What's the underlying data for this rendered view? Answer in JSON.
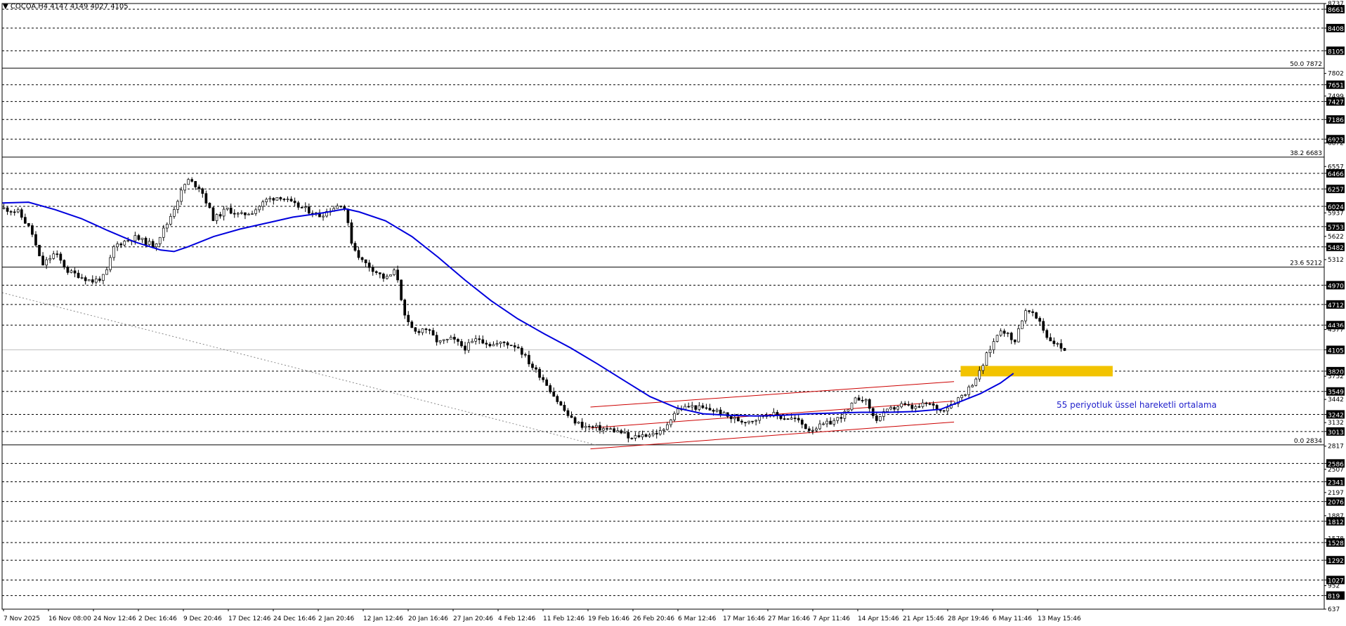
{
  "symbol_header": "▼ COCOA.H4  4147 4149 4027 4105",
  "chart_data": {
    "type": "candlestick",
    "symbol": "COCOA",
    "timeframe": "H4",
    "ohlc_header": {
      "open": 4147,
      "high": 4149,
      "low": 4027,
      "close": 4105
    },
    "ylim": [
      637,
      8737
    ],
    "price_ticks": [
      8737,
      8661,
      8408,
      8105,
      7802,
      7651,
      7499,
      7427,
      7186,
      6923,
      6872,
      6557,
      6466,
      6257,
      6024,
      5937,
      5753,
      5622,
      5482,
      5312,
      4970,
      4712,
      4436,
      4377,
      4105,
      3820,
      3752,
      3549,
      3442,
      3242,
      3132,
      3013,
      2817,
      2586,
      2507,
      2341,
      2197,
      2076,
      1887,
      1812,
      1578,
      1528,
      1292,
      1027,
      952,
      819,
      637
    ],
    "highlighted_ticks": [
      8661,
      8408,
      8105,
      7651,
      7427,
      7186,
      6923,
      6466,
      6257,
      6024,
      5753,
      5482,
      4970,
      4712,
      4436,
      4105,
      3820,
      3549,
      3242,
      3013,
      2586,
      2341,
      2076,
      1812,
      1528,
      1292,
      1027,
      819
    ],
    "support_resistance_levels": [
      8661,
      8408,
      8105,
      7651,
      7427,
      7186,
      6923,
      6466,
      6257,
      6024,
      5753,
      5482,
      4970,
      4712,
      4436,
      3820,
      3549,
      3242,
      3013,
      2586,
      2341,
      2076,
      1812,
      1528,
      1292,
      1027,
      819
    ],
    "current_price": 4105,
    "fibonacci": [
      {
        "label": "50.0 7872",
        "value": 7872
      },
      {
        "label": "38.2 6683",
        "value": 6683
      },
      {
        "label": "23.6 5212",
        "value": 5212
      },
      {
        "label": "0.0 2834",
        "value": 2834
      }
    ],
    "x_ticks": [
      "7 Nov 2025",
      "16 Nov 08:00",
      "24 Nov 12:46",
      "2 Dec 16:46",
      "9 Dec 20:46",
      "17 Dec 12:46",
      "24 Dec 16:46",
      "2 Jan 20:46",
      "12 Jan 12:46",
      "20 Jan 16:46",
      "27 Jan 20:46",
      "4 Feb 12:46",
      "11 Feb 12:46",
      "19 Feb 16:46",
      "26 Feb 20:46",
      "6 Mar 12:46",
      "17 Mar 16:46",
      "27 Mar 16:46",
      "7 Apr 11:46",
      "14 Apr 15:46",
      "21 Apr 15:46",
      "28 Apr 19:46",
      "6 May 11:46",
      "13 May 15:46"
    ],
    "ema": {
      "period": 55,
      "color": "#0000dd",
      "points": [
        [
          0,
          6070
        ],
        [
          0.02,
          6080
        ],
        [
          0.04,
          5980
        ],
        [
          0.06,
          5860
        ],
        [
          0.08,
          5700
        ],
        [
          0.1,
          5550
        ],
        [
          0.12,
          5440
        ],
        [
          0.13,
          5420
        ],
        [
          0.14,
          5480
        ],
        [
          0.16,
          5620
        ],
        [
          0.18,
          5720
        ],
        [
          0.2,
          5800
        ],
        [
          0.22,
          5880
        ],
        [
          0.24,
          5930
        ],
        [
          0.26,
          5990
        ],
        [
          0.27,
          5950
        ],
        [
          0.29,
          5830
        ],
        [
          0.31,
          5620
        ],
        [
          0.33,
          5340
        ],
        [
          0.35,
          5040
        ],
        [
          0.37,
          4760
        ],
        [
          0.39,
          4520
        ],
        [
          0.41,
          4320
        ],
        [
          0.43,
          4130
        ],
        [
          0.45,
          3920
        ],
        [
          0.47,
          3700
        ],
        [
          0.49,
          3480
        ],
        [
          0.51,
          3330
        ],
        [
          0.53,
          3250
        ],
        [
          0.55,
          3230
        ],
        [
          0.57,
          3220
        ],
        [
          0.59,
          3230
        ],
        [
          0.61,
          3250
        ],
        [
          0.63,
          3260
        ],
        [
          0.65,
          3270
        ],
        [
          0.67,
          3270
        ],
        [
          0.69,
          3280
        ],
        [
          0.71,
          3310
        ],
        [
          0.72,
          3380
        ],
        [
          0.74,
          3520
        ],
        [
          0.755,
          3660
        ],
        [
          0.765,
          3790
        ]
      ]
    },
    "channel": {
      "color": "#cc0000",
      "upper": [
        [
          0.445,
          3340
        ],
        [
          0.72,
          3680
        ]
      ],
      "middle": [
        [
          0.445,
          3060
        ],
        [
          0.72,
          3420
        ]
      ],
      "lower": [
        [
          0.445,
          2780
        ],
        [
          0.72,
          3140
        ]
      ]
    },
    "trendline": {
      "color": "#888888",
      "style": "dotted",
      "points": [
        [
          0,
          4870
        ],
        [
          0.45,
          2830
        ]
      ]
    },
    "zone": {
      "color": "#f2c300",
      "low": 3750,
      "high": 3890,
      "x_start": 0.725,
      "x_end": 0.84
    },
    "candle_path": [
      [
        0,
        6000
      ],
      [
        0.012,
        5950
      ],
      [
        0.022,
        5700
      ],
      [
        0.03,
        5230
      ],
      [
        0.04,
        5400
      ],
      [
        0.05,
        5150
      ],
      [
        0.058,
        5100
      ],
      [
        0.068,
        5020
      ],
      [
        0.078,
        5090
      ],
      [
        0.085,
        5500
      ],
      [
        0.1,
        5610
      ],
      [
        0.115,
        5500
      ],
      [
        0.125,
        5800
      ],
      [
        0.135,
        6200
      ],
      [
        0.14,
        6380
      ],
      [
        0.15,
        6270
      ],
      [
        0.16,
        5850
      ],
      [
        0.17,
        5990
      ],
      [
        0.18,
        5900
      ],
      [
        0.19,
        5960
      ],
      [
        0.2,
        6110
      ],
      [
        0.21,
        6160
      ],
      [
        0.22,
        6050
      ],
      [
        0.23,
        5980
      ],
      [
        0.24,
        5900
      ],
      [
        0.25,
        6000
      ],
      [
        0.258,
        6070
      ],
      [
        0.265,
        5500
      ],
      [
        0.272,
        5300
      ],
      [
        0.28,
        5190
      ],
      [
        0.29,
        5050
      ],
      [
        0.298,
        5170
      ],
      [
        0.305,
        4500
      ],
      [
        0.312,
        4340
      ],
      [
        0.32,
        4400
      ],
      [
        0.33,
        4200
      ],
      [
        0.34,
        4250
      ],
      [
        0.35,
        4130
      ],
      [
        0.36,
        4260
      ],
      [
        0.37,
        4170
      ],
      [
        0.38,
        4200
      ],
      [
        0.39,
        4150
      ],
      [
        0.4,
        3900
      ],
      [
        0.41,
        3700
      ],
      [
        0.42,
        3420
      ],
      [
        0.43,
        3180
      ],
      [
        0.44,
        3080
      ],
      [
        0.45,
        3060
      ],
      [
        0.46,
        3040
      ],
      [
        0.47,
        2990
      ],
      [
        0.475,
        2900
      ],
      [
        0.48,
        2950
      ],
      [
        0.49,
        2980
      ],
      [
        0.5,
        3010
      ],
      [
        0.505,
        3180
      ],
      [
        0.51,
        3300
      ],
      [
        0.52,
        3350
      ],
      [
        0.53,
        3320
      ],
      [
        0.54,
        3290
      ],
      [
        0.55,
        3200
      ],
      [
        0.56,
        3150
      ],
      [
        0.57,
        3180
      ],
      [
        0.58,
        3260
      ],
      [
        0.59,
        3200
      ],
      [
        0.6,
        3180
      ],
      [
        0.61,
        3040
      ],
      [
        0.62,
        3090
      ],
      [
        0.63,
        3160
      ],
      [
        0.64,
        3290
      ],
      [
        0.645,
        3430
      ],
      [
        0.65,
        3470
      ],
      [
        0.655,
        3380
      ],
      [
        0.66,
        3160
      ],
      [
        0.67,
        3290
      ],
      [
        0.68,
        3370
      ],
      [
        0.69,
        3320
      ],
      [
        0.7,
        3390
      ],
      [
        0.71,
        3290
      ],
      [
        0.72,
        3410
      ],
      [
        0.73,
        3560
      ],
      [
        0.74,
        3820
      ],
      [
        0.745,
        4050
      ],
      [
        0.75,
        4210
      ],
      [
        0.755,
        4390
      ],
      [
        0.76,
        4330
      ],
      [
        0.765,
        4180
      ],
      [
        0.77,
        4460
      ],
      [
        0.775,
        4640
      ],
      [
        0.78,
        4560
      ],
      [
        0.785,
        4490
      ],
      [
        0.79,
        4280
      ],
      [
        0.8,
        4147
      ],
      [
        0.805,
        4105
      ]
    ],
    "annotation": {
      "text": "55 periyotluk üssel hareketli ortalama",
      "color": "#2222cc"
    }
  }
}
